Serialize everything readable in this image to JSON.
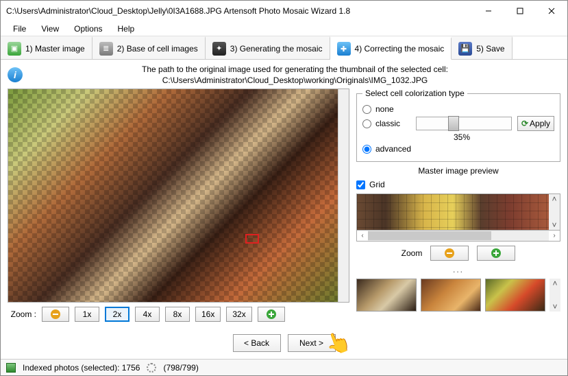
{
  "window": {
    "title": "C:\\Users\\Administrator\\Cloud_Desktop\\Jelly\\0I3A1688.JPG Artensoft Photo Mosaic Wizard 1.8"
  },
  "menu": [
    "File",
    "View",
    "Options",
    "Help"
  ],
  "steps": [
    {
      "label": "1) Master image"
    },
    {
      "label": "2) Base of cell images"
    },
    {
      "label": "3) Generating the mosaic"
    },
    {
      "label": "4) Correcting the mosaic"
    },
    {
      "label": "5) Save"
    }
  ],
  "path": {
    "line1": "The path to the original image used for generating the thumbnail of the selected cell:",
    "line2": "C:\\Users\\Administrator\\Cloud_Desktop\\working\\Originals\\IMG_1032.JPG"
  },
  "zoom": {
    "label": "Zoom  :",
    "levels": [
      "1x",
      "2x",
      "4x",
      "8x",
      "16x",
      "32x"
    ],
    "active": "2x"
  },
  "colorization": {
    "legend": "Select cell colorization type",
    "none": "none",
    "classic": "classic",
    "advanced": "advanced",
    "apply": "Apply",
    "percent": "35%",
    "selected": "advanced"
  },
  "preview": {
    "title": "Master image preview",
    "grid": "Grid",
    "zoom": "Zoom",
    "ellipsis": "..."
  },
  "nav": {
    "back": "< Back",
    "next": "Next >"
  },
  "status": {
    "indexed": "Indexed photos (selected): 1756",
    "progress": "(798/799)"
  }
}
